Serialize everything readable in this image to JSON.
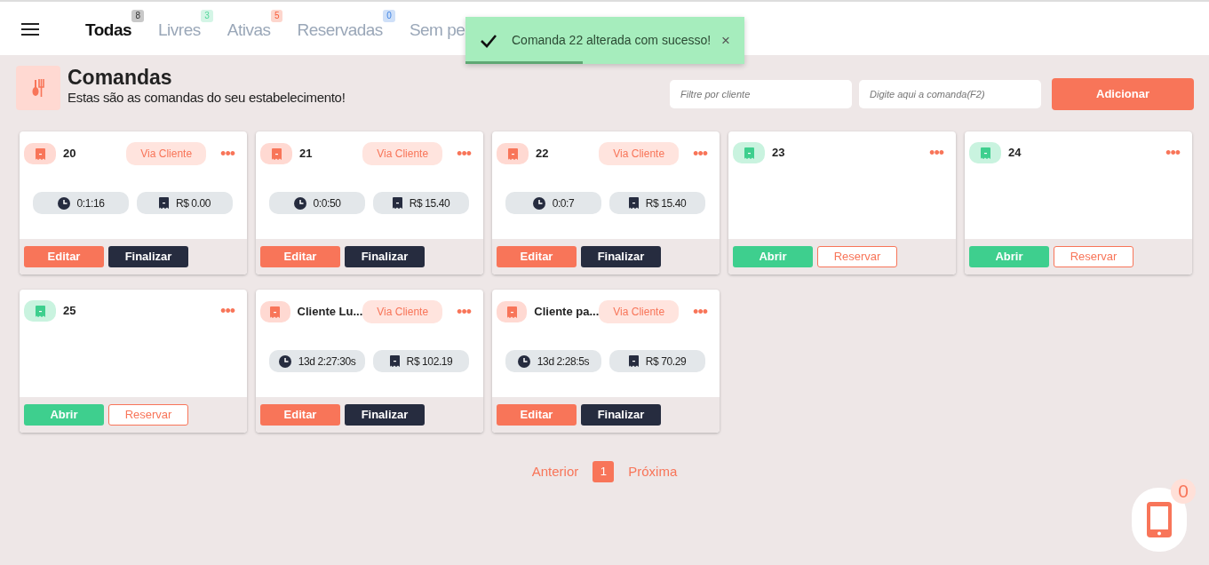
{
  "tabs": [
    {
      "label": "Todas",
      "count": "8",
      "selected": true,
      "color": "#c8c8c8"
    },
    {
      "label": "Livres",
      "count": "3",
      "selected": false,
      "color": "#d4f5e6"
    },
    {
      "label": "Ativas",
      "count": "5",
      "selected": false,
      "color": "#fdd6cd"
    },
    {
      "label": "Reservadas",
      "count": "0",
      "selected": false,
      "color": "#cfe0f8"
    },
    {
      "label": "Sem pe",
      "selected": false
    }
  ],
  "toast": {
    "message": "Comanda 22 alterada com sucesso!",
    "close": "×",
    "level": 0.42
  },
  "header": {
    "title": "Comandas",
    "subtitle": "Estas são as comandas do seu estabelecimento!"
  },
  "filters": [
    {
      "placeholder": "Filtre por cliente"
    },
    {
      "placeholder": "Digite aqui a comanda(F2)"
    }
  ],
  "add_button": "Adicionar",
  "cards": [
    {
      "kind": "active",
      "title": "20",
      "tag": "Via Cliente",
      "menu": "•••",
      "time": "0:1:16",
      "total": "R$ 0.00",
      "buttons": [
        "Editar",
        "Finalizar"
      ]
    },
    {
      "kind": "active",
      "title": "21",
      "tag": "Via Cliente",
      "menu": "•••",
      "time": "0:0:50",
      "total": "R$ 15.40",
      "buttons": [
        "Editar",
        "Finalizar"
      ]
    },
    {
      "kind": "active",
      "title": "22",
      "tag": "Via Cliente",
      "menu": "•••",
      "time": "0:0:7",
      "total": "R$ 15.40",
      "buttons": [
        "Editar",
        "Finalizar"
      ]
    },
    {
      "kind": "free",
      "title": "23",
      "menu": "•••",
      "buttons": [
        "Abrir",
        "Reservar"
      ]
    },
    {
      "kind": "free",
      "title": "24",
      "menu": "•••",
      "buttons": [
        "Abrir",
        "Reservar"
      ]
    },
    {
      "kind": "free",
      "title": "25",
      "menu": "•••",
      "buttons": [
        "Abrir",
        "Reservar"
      ]
    },
    {
      "kind": "active",
      "title": "Cliente Lu...",
      "tag": "Via Cliente",
      "menu": "•••",
      "time": "13d 2:27:30s",
      "total": "R$ 102.19",
      "buttons": [
        "Editar",
        "Finalizar"
      ]
    },
    {
      "kind": "active",
      "title": "Cliente pa...",
      "tag": "Via Cliente",
      "menu": "•••",
      "time": "13d 2:28:5s",
      "total": "R$ 70.29",
      "buttons": [
        "Editar",
        "Finalizar"
      ]
    }
  ],
  "pagination": {
    "previous": "Anterior",
    "pages": [
      {
        "label": "1",
        "selected": true
      }
    ],
    "next": "Próxima"
  },
  "phone_badge": "0"
}
